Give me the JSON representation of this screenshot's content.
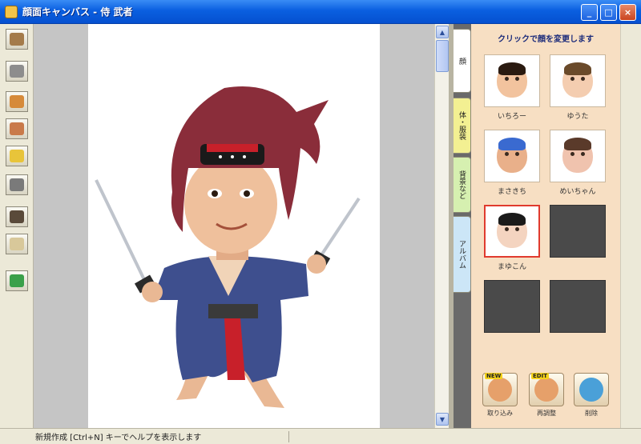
{
  "window": {
    "title": "顔面キャンバス - 侍 武者",
    "buttons": {
      "minimize": "_",
      "maximize": "□",
      "close": "×"
    }
  },
  "toolbar": {
    "tools": [
      {
        "icon": "character-icon",
        "color": "#a47b4a"
      },
      {
        "icon": "grid-icon",
        "color": "#8d8d8d"
      },
      {
        "icon": "edit-icon",
        "color": "#d68a3a"
      },
      {
        "icon": "person-icon",
        "color": "#c97a4a"
      },
      {
        "icon": "moon-icon",
        "color": "#e8c43a"
      },
      {
        "icon": "mosaic-icon",
        "color": "#7a7a7a"
      },
      {
        "icon": "film-icon",
        "color": "#5a4a3a"
      },
      {
        "icon": "note-icon",
        "color": "#d8c89a"
      },
      {
        "icon": "runner-icon",
        "color": "#3aa04a"
      }
    ]
  },
  "panel": {
    "heading": "クリックで顔を変更します",
    "tabs": [
      {
        "label": "顔",
        "color": "#ffffff"
      },
      {
        "label": "体・服装",
        "color": "#f3f092"
      },
      {
        "label": "背景など",
        "color": "#d6f0b0"
      },
      {
        "label": "アルバム",
        "color": "#cce6f7"
      }
    ],
    "photos": [
      {
        "caption": "いちろー",
        "hair": "#2a1a10",
        "skin": "#f2c39e",
        "selected": false,
        "empty": false
      },
      {
        "caption": "ゆうた",
        "hair": "#6a4a2a",
        "skin": "#f4cdb0",
        "selected": false,
        "empty": false
      },
      {
        "caption": "まさきち",
        "hair": "#3a6ad0",
        "skin": "#e9b08a",
        "selected": false,
        "empty": false
      },
      {
        "caption": "めいちゃん",
        "hair": "#5a3a2a",
        "skin": "#f0c3ae",
        "selected": false,
        "empty": false
      },
      {
        "caption": "まゆこん",
        "hair": "#1a1a1a",
        "skin": "#f4d4c0",
        "selected": true,
        "empty": false
      },
      {
        "caption": "",
        "hair": "",
        "skin": "",
        "selected": false,
        "empty": true
      },
      {
        "caption": "",
        "hair": "",
        "skin": "",
        "selected": false,
        "empty": true
      },
      {
        "caption": "",
        "hair": "",
        "skin": "",
        "selected": false,
        "empty": true
      }
    ],
    "bottom_buttons": [
      {
        "label": "取り込み",
        "badge": "NEW",
        "icon": "face-import-icon"
      },
      {
        "label": "再調整",
        "badge": "EDIT",
        "icon": "face-edit-icon"
      },
      {
        "label": "削除",
        "badge": "",
        "icon": "trash-icon"
      }
    ]
  },
  "status": {
    "text": "新規作成 [Ctrl+N] キーでヘルプを表示します"
  }
}
